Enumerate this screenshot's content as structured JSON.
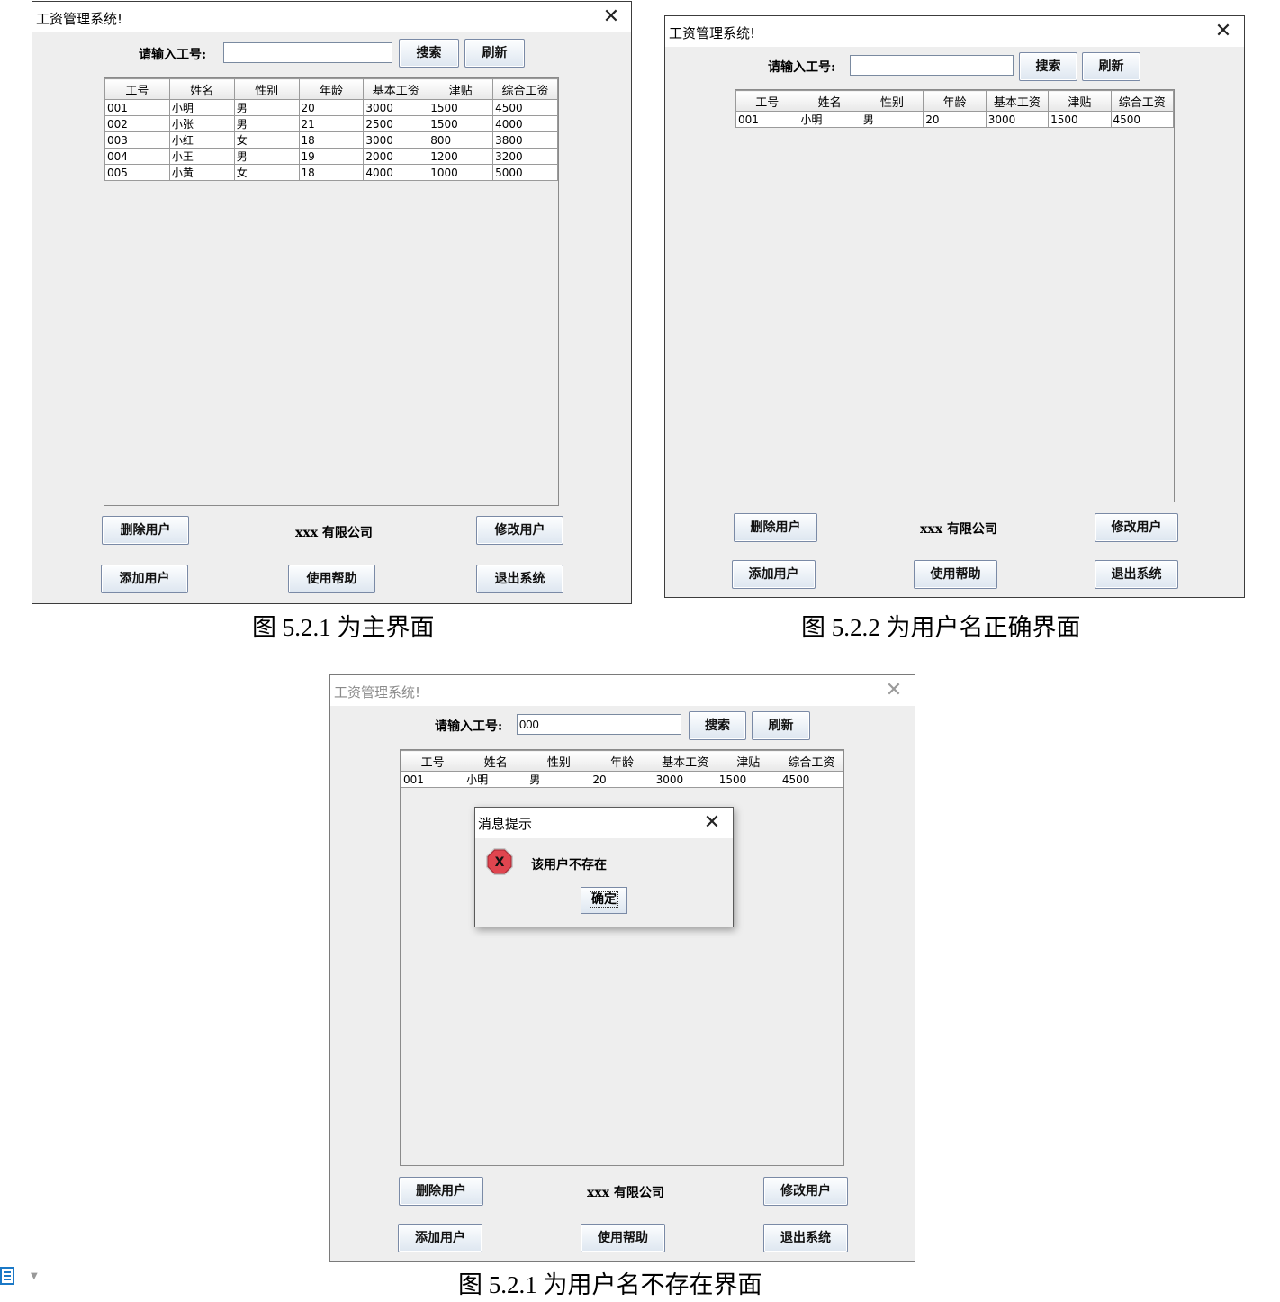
{
  "app": {
    "title": "工资管理系统!",
    "close_symbol": "✕",
    "search_label": "请输入工号:",
    "search_button": "搜索",
    "refresh_button": "刷新",
    "delete_button": "删除用户",
    "modify_button": "修改用户",
    "add_button": "添加用户",
    "help_button": "使用帮助",
    "exit_button": "退出系统",
    "company": "xxx 有限公司",
    "columns": [
      "工号",
      "姓名",
      "性别",
      "年龄",
      "基本工资",
      "津贴",
      "综合工资"
    ]
  },
  "win1": {
    "search_value": "",
    "rows": [
      [
        "001",
        "小明",
        "男",
        "20",
        "3000",
        "1500",
        "4500"
      ],
      [
        "002",
        "小张",
        "男",
        "21",
        "2500",
        "1500",
        "4000"
      ],
      [
        "003",
        "小红",
        "女",
        "18",
        "3000",
        "800",
        "3800"
      ],
      [
        "004",
        "小王",
        "男",
        "19",
        "2000",
        "1200",
        "3200"
      ],
      [
        "005",
        "小黄",
        "女",
        "18",
        "4000",
        "1000",
        "5000"
      ]
    ],
    "caption": "图 5.2.1  为主界面"
  },
  "win2": {
    "search_value": "",
    "rows": [
      [
        "001",
        "小明",
        "男",
        "20",
        "3000",
        "1500",
        "4500"
      ]
    ],
    "caption": "图 5.2.2  为用户名正确界面"
  },
  "win3": {
    "search_value": "000",
    "rows": [
      [
        "001",
        "小明",
        "男",
        "20",
        "3000",
        "1500",
        "4500"
      ]
    ],
    "caption": "图 5.2.1  为用户名不存在界面",
    "dialog": {
      "title": "消息提示",
      "message": "该用户不存在",
      "ok": "确定",
      "icon_letter": "X"
    }
  },
  "colors": {
    "window_bg": "#eeeeee",
    "error_icon": "#e0454f"
  }
}
